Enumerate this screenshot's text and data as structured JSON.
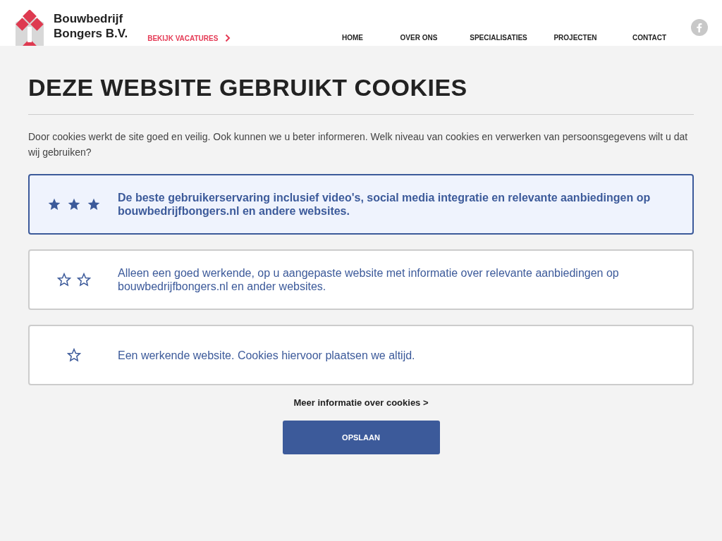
{
  "header": {
    "logo_line_1": "Bouwbedrijf",
    "logo_line_2": "Bongers B.V.",
    "vacancies_link": "BEKIJK VACATURES",
    "nav": [
      "HOME",
      "OVER ONS",
      "SPECIALISATIES",
      "PROJECTEN",
      "CONTACT"
    ]
  },
  "dialog": {
    "title": "DEZE WEBSITE GEBRUIKT COOKIES",
    "intro": "Door cookies werkt de site goed en veilig. Ook kunnen we u beter informeren. Welk niveau van cookies en verwerken van persoonsgegevens wilt u dat wij gebruiken?",
    "options": [
      {
        "selected": true,
        "stars": [
          {
            "filled": true
          },
          {
            "filled": true
          },
          {
            "filled": true
          }
        ],
        "text": "De beste gebruikerservaring inclusief video's, social media integratie en relevante aanbiedingen op bouwbedrijfbongers.nl en andere websites."
      },
      {
        "selected": false,
        "stars": [
          {
            "filled": false
          },
          {
            "filled": false
          }
        ],
        "text": "Alleen een goed werkende, op u aangepaste website met informatie over relevante aanbiedingen op bouwbedrijfbongers.nl en ander websites."
      },
      {
        "selected": false,
        "stars": [
          {
            "filled": false
          }
        ],
        "text": "Een werkende website. Cookies hiervoor plaatsen we altijd."
      }
    ],
    "more_info_link": "Meer informatie over cookies >",
    "save_button": "OPSLAAN"
  }
}
